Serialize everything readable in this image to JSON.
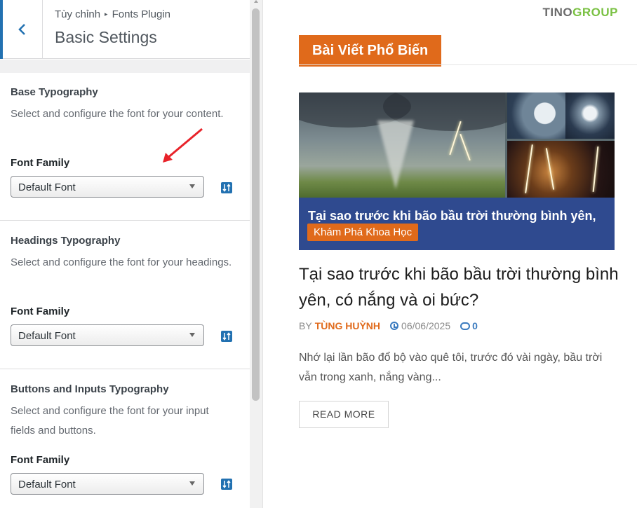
{
  "customizer": {
    "breadcrumb": {
      "root": "Tùy chỉnh",
      "current": "Fonts Plugin"
    },
    "title": "Basic Settings",
    "sections": [
      {
        "heading": "Base Typography",
        "description": "Select and configure the font for your content.",
        "field_label": "Font Family",
        "selected_font": "Default Font"
      },
      {
        "heading": "Headings Typography",
        "description": "Select and configure the font for your headings.",
        "field_label": "Font Family",
        "selected_font": "Default Font"
      },
      {
        "heading": "Buttons and Inputs Typography",
        "description": "Select and configure the font for your input fields and buttons.",
        "field_label": "Font Family",
        "selected_font": "Default Font"
      }
    ],
    "accent_color": "#2271b1"
  },
  "preview": {
    "logo": {
      "part1": "TINO",
      "part2": "GROUP"
    },
    "section_tab": "Bài Viết Phổ Biến",
    "featured": {
      "overlay_title": "Tại sao trước khi bão bầu trời thường bình yên,",
      "category": "Khám Phá Khoa Học"
    },
    "post": {
      "title": "Tại sao trước khi bão bầu trời thường bình yên, có nắng và oi bức?",
      "by": "BY",
      "author": "TÙNG HUỲNH",
      "date": "06/06/2025",
      "comments": "0",
      "excerpt": "Nhớ lại lần bão đổ bộ vào quê tôi, trước đó vài ngày, bầu trời vẫn trong xanh, nắng vàng...",
      "read_more": "READ MORE"
    },
    "accent_color": "#e06a1b"
  }
}
